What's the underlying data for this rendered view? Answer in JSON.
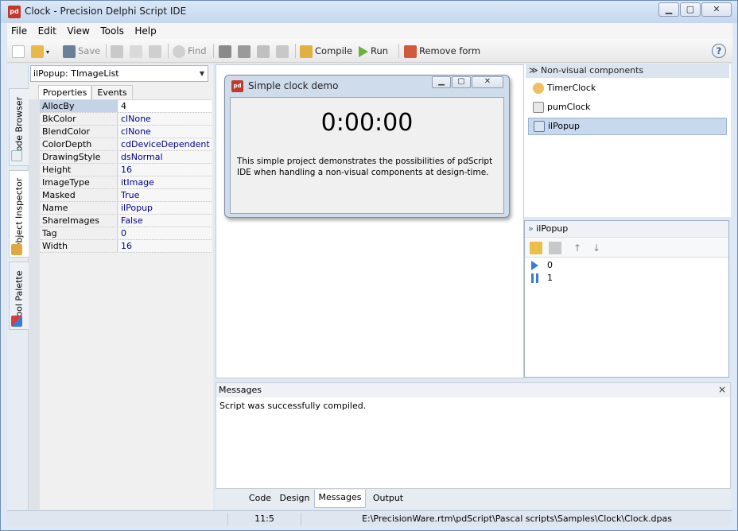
{
  "window": {
    "app_icon_text": "pd",
    "title": "Clock - Precision Delphi Script IDE",
    "min_label": "▁",
    "max_label": "▢",
    "close_label": "✕"
  },
  "menu": [
    "File",
    "Edit",
    "View",
    "Tools",
    "Help"
  ],
  "toolbar": {
    "save": "Save",
    "find": "Find",
    "compile": "Compile",
    "run": "Run",
    "remove_form": "Remove form",
    "help_icon": "?"
  },
  "side_tabs": {
    "code_browser": "Code Browser",
    "object_inspector": "Object Inspector",
    "tool_palette": "Tool Palette"
  },
  "inspector": {
    "component": "ilPopup: TImageList",
    "tabs": [
      "Properties",
      "Events"
    ],
    "properties": [
      {
        "name": "AllocBy",
        "value": "4"
      },
      {
        "name": "BkColor",
        "value": "clNone"
      },
      {
        "name": "BlendColor",
        "value": "clNone"
      },
      {
        "name": "ColorDepth",
        "value": "cdDeviceDependent"
      },
      {
        "name": "DrawingStyle",
        "value": "dsNormal"
      },
      {
        "name": "Height",
        "value": "16"
      },
      {
        "name": "ImageType",
        "value": "itImage"
      },
      {
        "name": "Masked",
        "value": "True"
      },
      {
        "name": "Name",
        "value": "ilPopup"
      },
      {
        "name": "ShareImages",
        "value": "False"
      },
      {
        "name": "Tag",
        "value": "0"
      },
      {
        "name": "Width",
        "value": "16"
      }
    ]
  },
  "form": {
    "icon_text": "pd",
    "title": "Simple clock demo",
    "clock": "0:00:00",
    "description": "This simple project demonstrates the possibilities of pdScript IDE when handling a non-visual components at design-time."
  },
  "nonvisual": {
    "header": "Non-visual components",
    "items": [
      "TimerClock",
      "pumClock",
      "ilPopup"
    ]
  },
  "imagelist": {
    "header": "ilPopup",
    "items": [
      "0",
      "1"
    ]
  },
  "messages": {
    "header": "Messages",
    "close": "×",
    "text": "Script was successfully compiled."
  },
  "bottom_tabs": [
    "Code",
    "Design",
    "Messages",
    "Output"
  ],
  "status": {
    "position": "11:5",
    "path": "E:\\PrecisionWare.rtm\\pdScript\\Pascal scripts\\Samples\\Clock\\Clock.dpas"
  },
  "colors": {
    "window_bg": "#dfe9f5",
    "selection": "#c4d3e6",
    "value_text": "#00008b",
    "icon_red": "#c0392b"
  }
}
